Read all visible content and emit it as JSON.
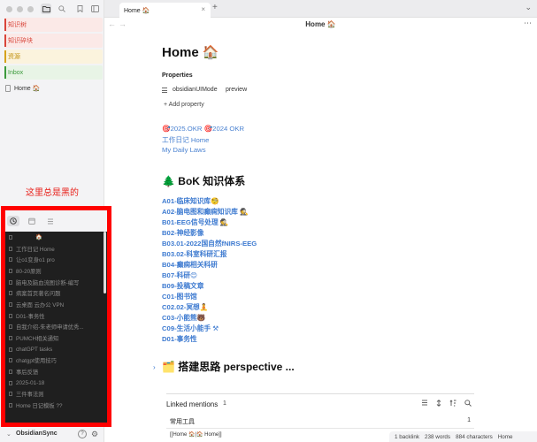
{
  "tab": {
    "title": "Home 🏠",
    "close": "×",
    "new": "+",
    "more": "⌄"
  },
  "nav": {
    "back": "←",
    "forward": "→",
    "title": "Home 🏠",
    "more": "⋯"
  },
  "sidebar": {
    "tools": [
      "folder",
      "search",
      "bookmark",
      "layout"
    ],
    "folders": [
      {
        "label": "知识树",
        "color": "#d9453a"
      },
      {
        "label": "知识碎块",
        "color": "#d9453a"
      },
      {
        "label": "资源",
        "color": "#d6a21b"
      },
      {
        "label": "Inbox",
        "color": "#3c9a3c"
      }
    ],
    "file": "Home 🏠",
    "note": "这里总是黑的",
    "recent_tabs": [
      "clock-icon",
      "calendar-icon",
      "list-icon"
    ],
    "recent": [
      "🏠",
      "工作日记 Home",
      "让o1变身o1 pro",
      "80-20原则",
      "脑电及脑血流图诊断-编写",
      "病案首页著名问题",
      "云桌面 云办公 VPN",
      "D01-事务性",
      "自我介绍-朱老师申请优秀...",
      "PUMCH相关通知",
      "chatGPT tasks",
      "chatgpt使用技巧",
      "事后反馈",
      "2025-01-18",
      "三件事法则",
      "Home 日记模板 ??"
    ],
    "vault": "ObsidianSync",
    "vault_chevron": "⌄",
    "help": "?",
    "settings": "⚙"
  },
  "doc": {
    "title": "Home 🏠",
    "properties_heading": "Properties",
    "property": {
      "key": "obsidianUIMode",
      "value": "preview"
    },
    "add_property": "+ Add property",
    "top_links": [
      "🎯2025.OKR 🎯2024 OKR",
      "工作日记 Home",
      "My Daily Laws"
    ],
    "bok_heading": "🌲 BoK 知识体系",
    "bok_links": [
      "A01-临床知识库🧐",
      "A02-脑电图和癫痫知识库 🕵",
      "B01-EEG信号处理 🕵",
      "B02-神经影像",
      "B03.01-2022国自然fNIRS-EEG",
      "B03.02-科室科研汇报",
      "B04-癫痫相关科研",
      "B07-科研😊",
      "B09-投稿文章",
      "C01-图书馆",
      "C02.02-冥想🧘",
      "C03-小能熊🐻",
      "C09-生活小能手 ⚒",
      "D01-事务性"
    ],
    "perspective_heading": "🗂️ 搭建思路 perspective ...",
    "fold_arrow": "›"
  },
  "linked": {
    "title": "Linked mentions",
    "count": "1",
    "icons": [
      "list-icon",
      "expand-icon",
      "sort-icon",
      "search-icon"
    ],
    "group": "常用工具",
    "group_count": "1",
    "reference": "[[Home 🏠|🏠 Home]]"
  },
  "status": {
    "backlinks": "1 backlink",
    "words": "238 words",
    "chars": "884 characters",
    "view": "Home"
  }
}
